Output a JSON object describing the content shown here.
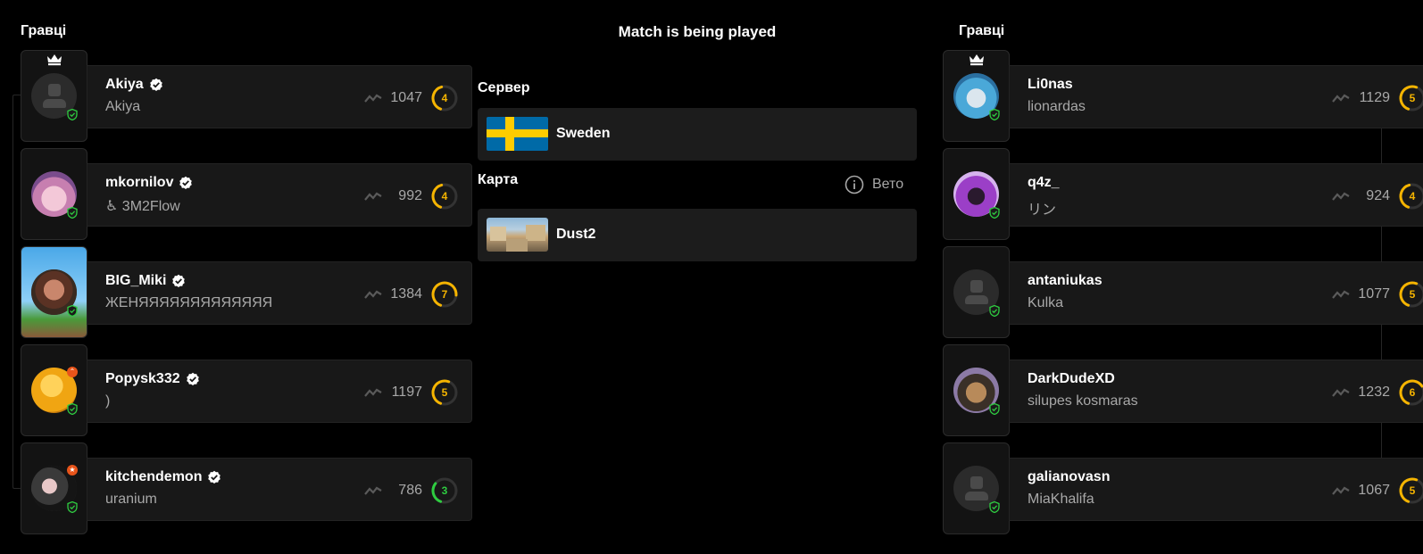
{
  "center": {
    "title": "Match is being played",
    "server_label": "Сервер",
    "server_value": "Sweden",
    "server_flag_icon": "sweden-flag-icon",
    "map_label": "Карта",
    "map_value": "Dust2",
    "veto_label": "Вето"
  },
  "left_team": {
    "heading": "Гравці",
    "players": [
      {
        "name": "Akiya",
        "nick": "Akiya",
        "elo": "1047",
        "level": "4",
        "level_color": "#f5b400",
        "level_fill": 0.4,
        "verified": true,
        "leader": true,
        "avatar": "placeholder"
      },
      {
        "name": "mkornilov",
        "nick": "♿ 3M2Flow",
        "elo": "992",
        "level": "4",
        "level_color": "#f5b400",
        "level_fill": 0.4,
        "verified": true,
        "leader": false,
        "avatar": "anime"
      },
      {
        "name": "BIG_Miki",
        "nick": "ЖЕНЯЯЯЯЯЯЯЯЯЯЯЯЯ",
        "elo": "1384",
        "level": "7",
        "level_color": "#f5b400",
        "level_fill": 0.7,
        "verified": true,
        "leader": false,
        "avatar": "pixel"
      },
      {
        "name": "Popysk332",
        "nick": ")",
        "elo": "1197",
        "level": "5",
        "level_color": "#f5b400",
        "level_fill": 0.5,
        "verified": true,
        "leader": false,
        "avatar": "coin"
      },
      {
        "name": "kitchendemon",
        "nick": "uranium",
        "elo": "786",
        "level": "3",
        "level_color": "#2ecc40",
        "level_fill": 0.3,
        "verified": true,
        "leader": false,
        "avatar": "dark"
      }
    ]
  },
  "right_team": {
    "heading": "Гравці",
    "players": [
      {
        "name": "Li0nas",
        "nick": "lionardas",
        "elo": "1129",
        "level": "5",
        "level_color": "#f5b400",
        "level_fill": 0.5,
        "verified": false,
        "leader": true,
        "avatar": "blue"
      },
      {
        "name": "q4z_",
        "nick": "リン",
        "elo": "924",
        "level": "4",
        "level_color": "#f5b400",
        "level_fill": 0.4,
        "verified": false,
        "leader": false,
        "avatar": "purple"
      },
      {
        "name": "antaniukas",
        "nick": "Kulka",
        "elo": "1077",
        "level": "5",
        "level_color": "#f5b400",
        "level_fill": 0.5,
        "verified": false,
        "leader": false,
        "avatar": "placeholder"
      },
      {
        "name": "DarkDudeXD",
        "nick": "silupes kosmaras",
        "elo": "1232",
        "level": "6",
        "level_color": "#f5b400",
        "level_fill": 0.6,
        "verified": false,
        "leader": false,
        "avatar": "dog"
      },
      {
        "name": "galianovasn",
        "nick": "MiaKhalifa",
        "elo": "1067",
        "level": "5",
        "level_color": "#f5b400",
        "level_fill": 0.5,
        "verified": false,
        "leader": false,
        "avatar": "placeholder"
      }
    ]
  }
}
